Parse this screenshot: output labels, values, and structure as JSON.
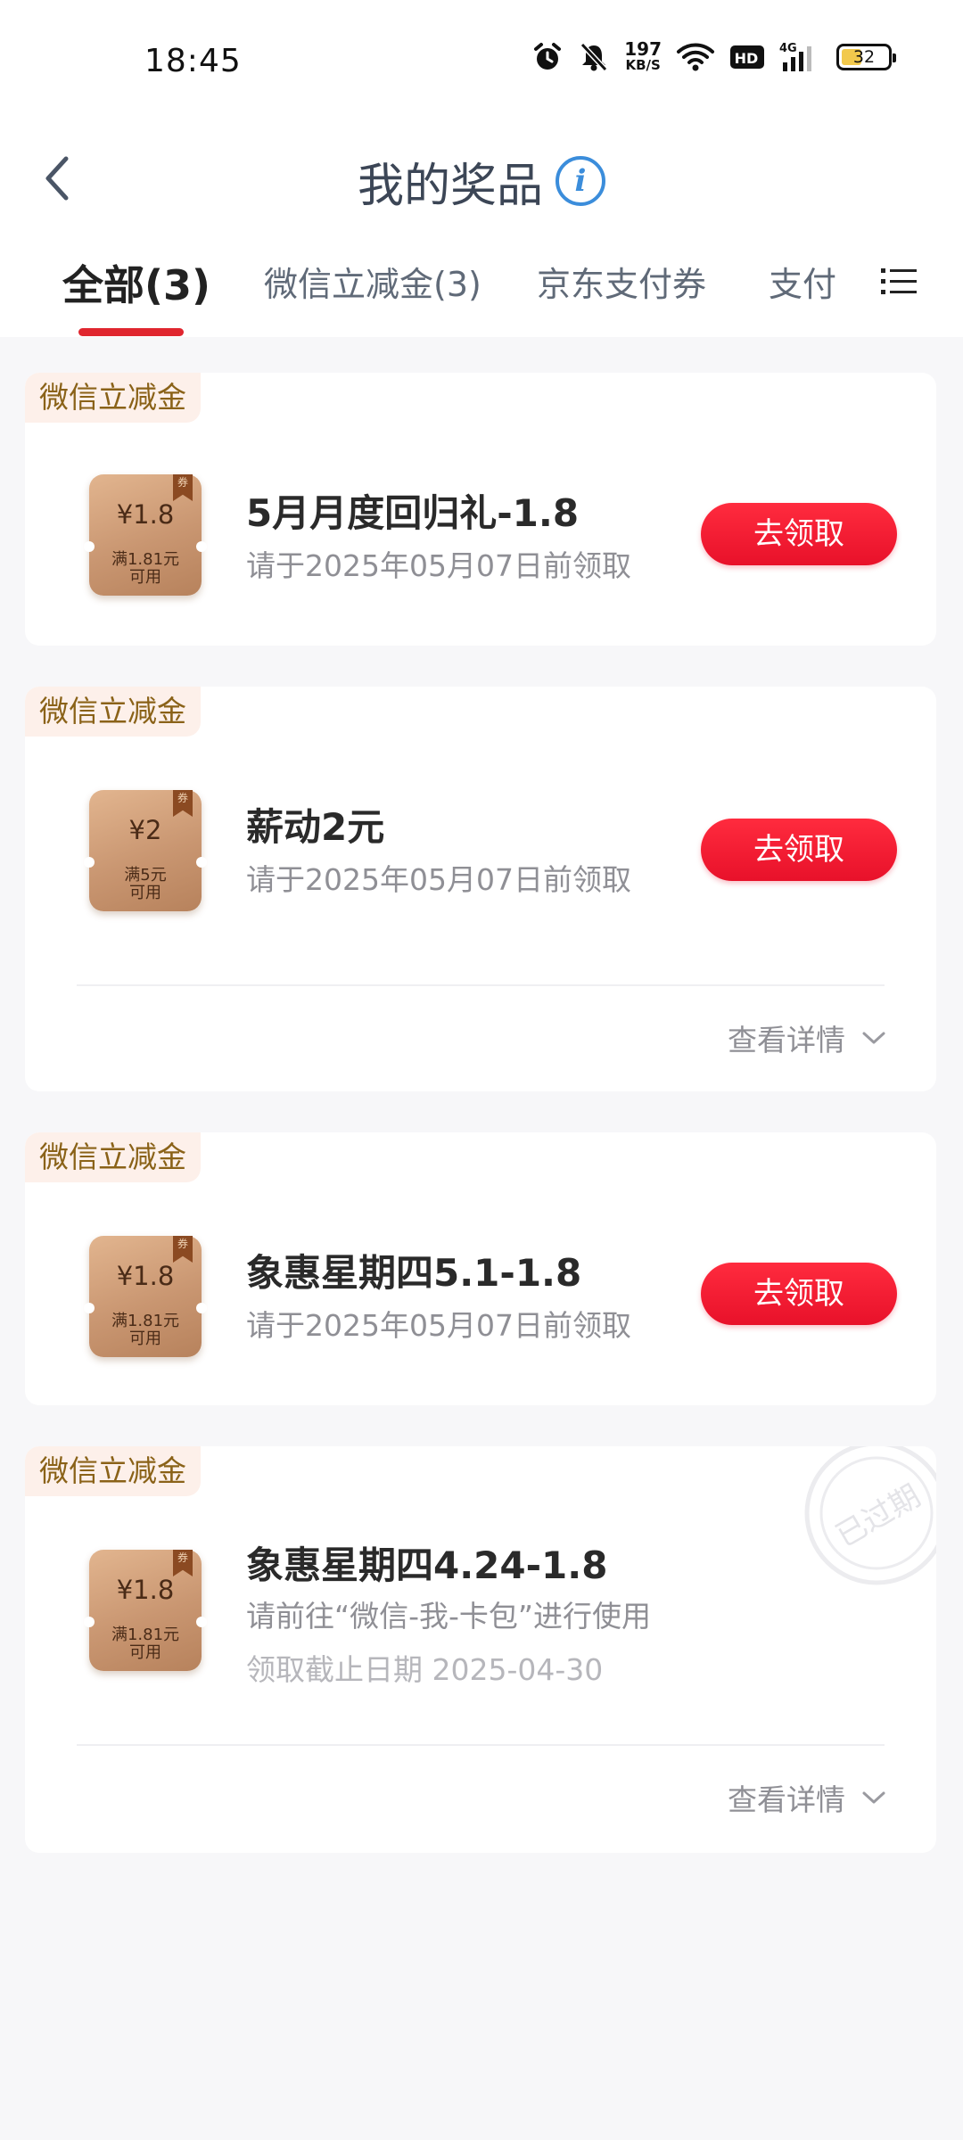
{
  "status_bar": {
    "time": "18:45",
    "net_speed_value": "197",
    "net_speed_unit": "KB/S",
    "hd_label": "HD",
    "network_type": "4G",
    "battery_level": "32"
  },
  "nav": {
    "title": "我的奖品",
    "info_icon_glyph": "i"
  },
  "tabs": [
    {
      "label": "全部(3)",
      "active": true
    },
    {
      "label": "微信立减金(3)",
      "active": false
    },
    {
      "label": "京东支付券",
      "active": false
    },
    {
      "label": "支付",
      "active": false
    }
  ],
  "prizes": [
    {
      "tag": "微信立减金",
      "coupon_amount": "¥1.8",
      "coupon_condition_1": "满1.81元",
      "coupon_condition_2": "可用",
      "coupon_badge": "券",
      "title": "5月月度回归礼-1.8",
      "subtitle": "请于2025年05月07日前领取",
      "button_label": "去领取"
    },
    {
      "tag": "微信立减金",
      "coupon_amount": "¥2",
      "coupon_condition_1": "满5元",
      "coupon_condition_2": "可用",
      "coupon_badge": "券",
      "title": "薪动2元",
      "subtitle": "请于2025年05月07日前领取",
      "button_label": "去领取",
      "details_label": "查看详情"
    },
    {
      "tag": "微信立减金",
      "coupon_amount": "¥1.8",
      "coupon_condition_1": "满1.81元",
      "coupon_condition_2": "可用",
      "coupon_badge": "券",
      "title": "象惠星期四5.1-1.8",
      "subtitle": "请于2025年05月07日前领取",
      "button_label": "去领取"
    },
    {
      "tag": "微信立减金",
      "coupon_amount": "¥1.8",
      "coupon_condition_1": "满1.81元",
      "coupon_condition_2": "可用",
      "coupon_badge": "券",
      "title": "象惠星期四4.24-1.8",
      "subtitle": "请前往“微信-我-卡包”进行使用",
      "deadline": "领取截止日期 2025-04-30",
      "stamp_text": "已过期",
      "details_label": "查看详情"
    }
  ],
  "colors": {
    "accent_red": "#e8112a",
    "tab_underline": "#e0262f",
    "tag_background": "#fdf0ea",
    "tag_text": "#8a6218",
    "info_blue": "#3b8ddb",
    "page_background": "#f7f7f9"
  },
  "icons": {
    "back": "chevron-left-icon",
    "info": "info-circle-icon",
    "menu": "list-menu-icon",
    "details": "chevron-down-icon"
  }
}
